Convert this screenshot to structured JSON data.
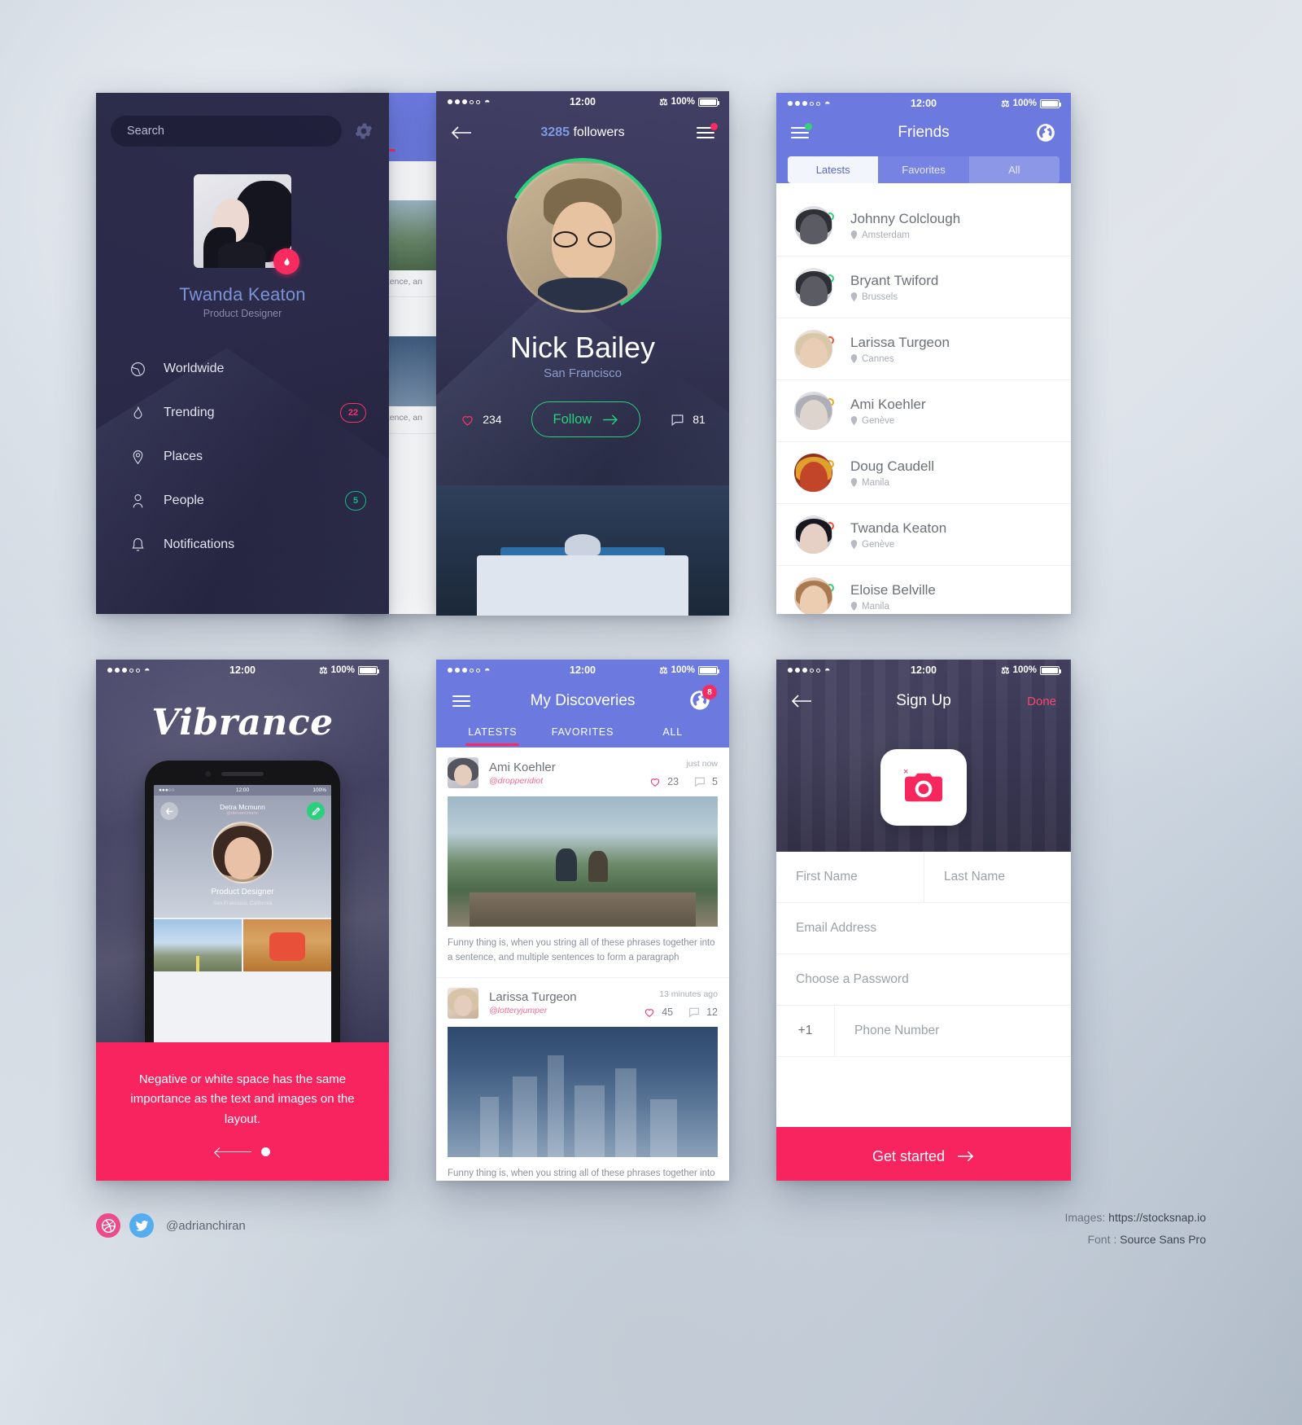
{
  "meta": {
    "status_time": "12:00",
    "status_battery": "100%"
  },
  "screen1": {
    "name": "sidebar-menu-screen",
    "search_placeholder": "Search",
    "profile_name": "Twanda Keaton",
    "profile_role": "Product Designer",
    "menu": [
      {
        "label": "Worldwide",
        "icon": "globe-icon",
        "badge": ""
      },
      {
        "label": "Trending",
        "icon": "flame-icon",
        "badge": "22",
        "badge_color": "#f3356b"
      },
      {
        "label": "Places",
        "icon": "pin-icon",
        "badge": ""
      },
      {
        "label": "People",
        "icon": "person-icon",
        "badge": "5",
        "badge_color": "#17b98a"
      },
      {
        "label": "Notifications",
        "icon": "bell-icon",
        "badge": ""
      }
    ],
    "peek_caption_1": "Funny th tence, an",
    "peek_caption_2": "Funny th tence, an"
  },
  "screen2": {
    "name": "profile-screen",
    "followers_count": "3285",
    "followers_label": "followers",
    "user_name": "Nick Bailey",
    "user_city": "San Francisco",
    "likes": "234",
    "comments": "81",
    "follow_label": "Follow"
  },
  "screen3": {
    "name": "friends-screen",
    "title": "Friends",
    "tabs": [
      {
        "label": "Latests",
        "active": true
      },
      {
        "label": "Favorites",
        "active": false
      },
      {
        "label": "All",
        "active": false
      }
    ],
    "friends": [
      {
        "name": "Johnny Colclough",
        "location": "Amsterdam",
        "status": "green"
      },
      {
        "name": "Bryant Twiford",
        "location": "Brussels",
        "status": "green"
      },
      {
        "name": "Larissa Turgeon",
        "location": "Cannes",
        "status": "red"
      },
      {
        "name": "Ami Koehler",
        "location": "Genève",
        "status": "amber"
      },
      {
        "name": "Doug Caudell",
        "location": "Manila",
        "status": "amber"
      },
      {
        "name": "Twanda Keaton",
        "location": "Genève",
        "status": "red"
      },
      {
        "name": "Eloise Belville",
        "location": "Manila",
        "status": "green"
      }
    ]
  },
  "screen4": {
    "name": "vibrance-promo-screen",
    "logo": "Vibrance",
    "caption": "Negative or white space has the same importance as the text and images on the layout.",
    "mock": {
      "time": "12:00",
      "battery": "100%",
      "name": "Detra Mcmunn",
      "handle": "@detramcmunn",
      "role": "Product Designer",
      "sub": "San Francisco, California"
    }
  },
  "screen5": {
    "name": "my-discoveries-screen",
    "title": "My Discoveries",
    "globe_badge": "8",
    "tabs": [
      {
        "label": "LATESTS",
        "active": true
      },
      {
        "label": "FAVORITES",
        "active": false
      },
      {
        "label": "ALL",
        "active": false
      }
    ],
    "posts": [
      {
        "author": "Ami Koehler",
        "handle": "@dropperidiot",
        "time": "just now",
        "likes": "23",
        "comments": "5",
        "text": "Funny thing is, when you string all of these phrases together into a sentence, and multiple sentences to form a paragraph"
      },
      {
        "author": "Larissa Turgeon",
        "handle": "@lotteryjumper",
        "time": "13 minutes ago",
        "likes": "45",
        "comments": "12",
        "text": "Funny thing is, when you string all of these phrases together into a sentence, and multiple sentences to form a paragraph"
      }
    ]
  },
  "screen6": {
    "name": "sign-up-screen",
    "title": "Sign Up",
    "done_label": "Done",
    "fields": {
      "first_name": "First Name",
      "last_name": "Last Name",
      "email": "Email Address",
      "password": "Choose a Password",
      "country_code": "+1",
      "phone": "Phone Number"
    },
    "cta_label": "Get started"
  },
  "footer": {
    "handle": "@adrianchiran",
    "images_label": "Images:",
    "images_value": "https://stocksnap.io",
    "font_label": "Font :",
    "font_value": "Source Sans Pro"
  }
}
